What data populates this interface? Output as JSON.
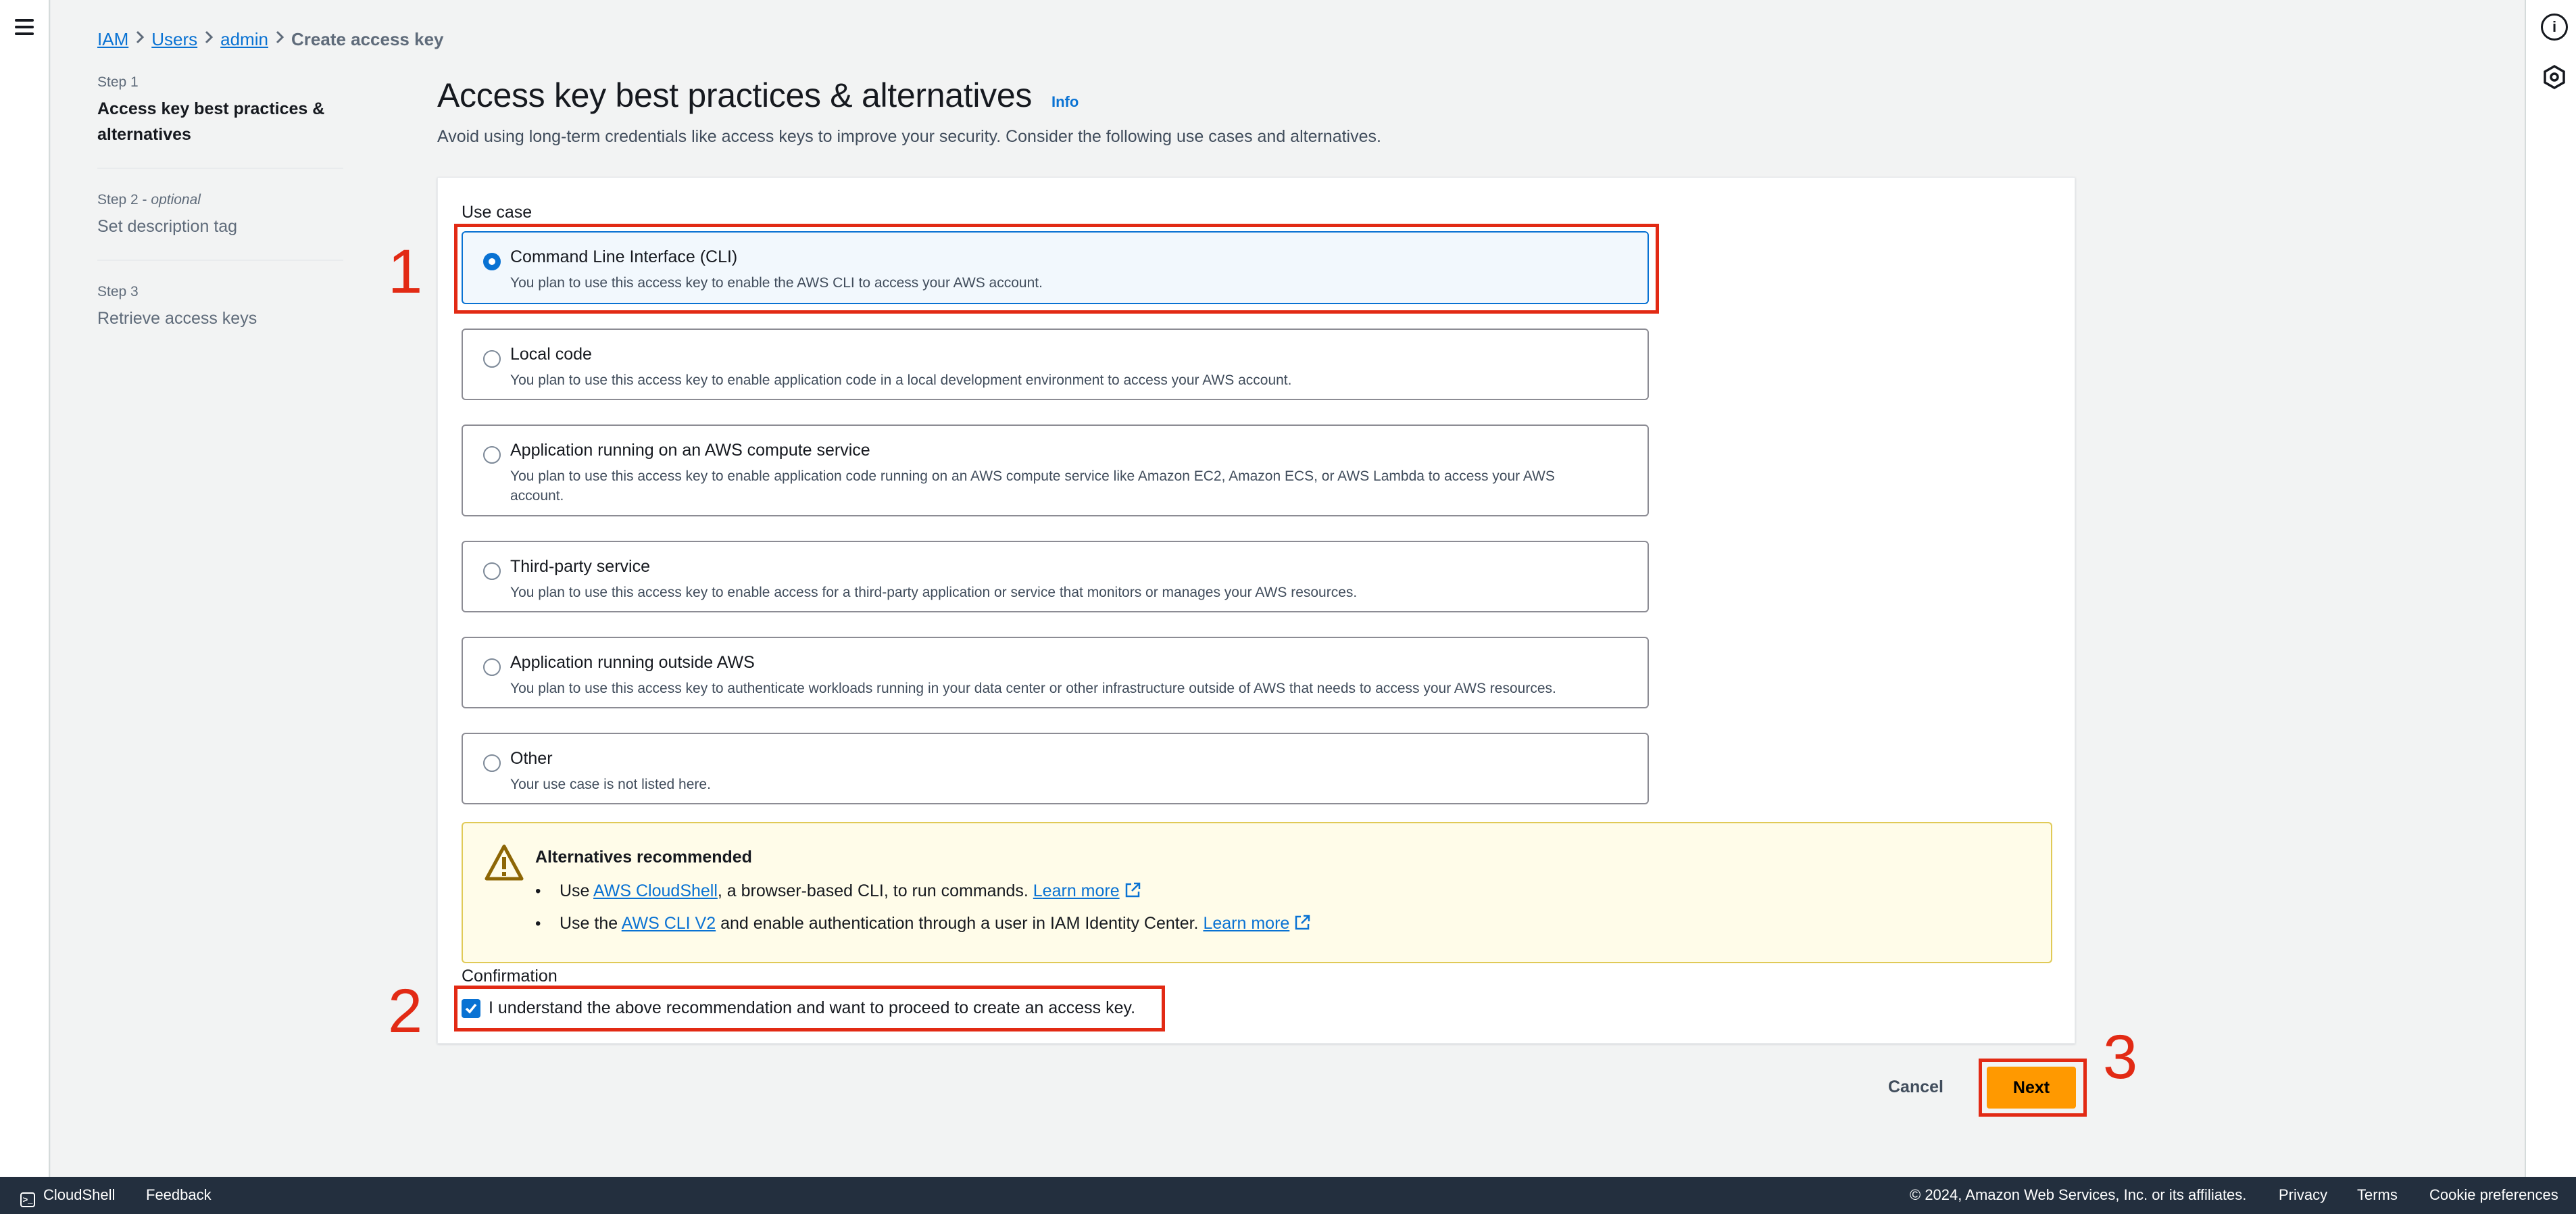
{
  "breadcrumb": [
    "IAM",
    "Users",
    "admin",
    "Create access key"
  ],
  "steps": [
    {
      "label": "Step 1",
      "title": "Access key best practices & alternatives"
    },
    {
      "label": "Step 2",
      "optional": "optional",
      "title": "Set description tag"
    },
    {
      "label": "Step 3",
      "title": "Retrieve access keys"
    }
  ],
  "header": {
    "title": "Access key best practices & alternatives",
    "info": "Info",
    "description": "Avoid using long-term credentials like access keys to improve your security. Consider the following use cases and alternatives."
  },
  "use_case": {
    "label": "Use case",
    "selected": "Command Line Interface (CLI)",
    "options": [
      {
        "title": "Command Line Interface (CLI)",
        "desc": "You plan to use this access key to enable the AWS CLI to access your AWS account."
      },
      {
        "title": "Local code",
        "desc": "You plan to use this access key to enable application code in a local development environment to access your AWS account."
      },
      {
        "title": "Application running on an AWS compute service",
        "desc": "You plan to use this access key to enable application code running on an AWS compute service like Amazon EC2, Amazon ECS, or AWS Lambda to access your AWS account."
      },
      {
        "title": "Third-party service",
        "desc": "You plan to use this access key to enable access for a third-party application or service that monitors or manages your AWS resources."
      },
      {
        "title": "Application running outside AWS",
        "desc": "You plan to use this access key to authenticate workloads running in your data center or other infrastructure outside of AWS that needs to access your AWS resources."
      },
      {
        "title": "Other",
        "desc": "Your use case is not listed here."
      }
    ]
  },
  "alert": {
    "title": "Alternatives recommended",
    "items": [
      {
        "pre": "Use ",
        "link": "AWS CloudShell",
        "post": ", a browser-based CLI, to run commands. ",
        "learn": "Learn more"
      },
      {
        "pre": "Use the ",
        "link": "AWS CLI V2",
        "post": " and enable authentication through a user in IAM Identity Center. ",
        "learn": "Learn more"
      }
    ]
  },
  "confirmation": {
    "label": "Confirmation",
    "text": "I understand the above recommendation and want to proceed to create an access key.",
    "checked": true
  },
  "actions": {
    "cancel": "Cancel",
    "next": "Next"
  },
  "annotations": [
    "1",
    "2",
    "3"
  ],
  "footer": {
    "cloudshell": "CloudShell",
    "feedback": "Feedback",
    "copyright": "© 2024, Amazon Web Services, Inc. or its affiliates.",
    "privacy": "Privacy",
    "terms": "Terms",
    "cookies": "Cookie preferences"
  },
  "colors": {
    "accent": "#0972d3",
    "primary_button": "#ff9900",
    "annotation": "#e22a14",
    "footer_bg": "#232f3e"
  }
}
